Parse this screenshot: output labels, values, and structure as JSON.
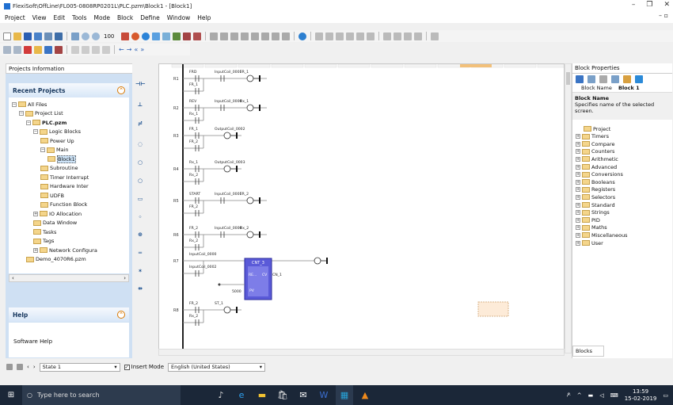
{
  "window": {
    "title": "FlexiSoft\\OffLine\\FL005-0808RP0201L\\PLC.pzm\\Block1 - [Block1]",
    "controls": [
      "–",
      "❐",
      "✕"
    ]
  },
  "menu": [
    "Project",
    "View",
    "Edit",
    "Tools",
    "Mode",
    "Block",
    "Define",
    "Window",
    "Help"
  ],
  "toolbar": {
    "zoom": "100"
  },
  "projects_panel": {
    "title": "Projects Information",
    "pin": "⊕‹",
    "recent_label": "Recent Projects",
    "tree": [
      {
        "label": "All Files",
        "level": 0,
        "pm": "−"
      },
      {
        "label": "Project List",
        "level": 1,
        "pm": "−"
      },
      {
        "label": "PLC.pzm",
        "level": 2,
        "pm": "−",
        "bold": true
      },
      {
        "label": "Logic Blocks",
        "level": 3,
        "pm": "−"
      },
      {
        "label": "Power Up",
        "level": 4,
        "pm": ""
      },
      {
        "label": "Main",
        "level": 4,
        "pm": "−"
      },
      {
        "label": "Block1",
        "level": 5,
        "pm": "",
        "selected": true
      },
      {
        "label": "Subroutine",
        "level": 4,
        "pm": ""
      },
      {
        "label": "Timer Interrupt",
        "level": 4,
        "pm": ""
      },
      {
        "label": "Hardware Inter",
        "level": 4,
        "pm": ""
      },
      {
        "label": "UDFB",
        "level": 4,
        "pm": ""
      },
      {
        "label": "Function Block",
        "level": 4,
        "pm": ""
      },
      {
        "label": "IO Allocation",
        "level": 3,
        "pm": "+"
      },
      {
        "label": "Data Window",
        "level": 3,
        "pm": ""
      },
      {
        "label": "Tasks",
        "level": 3,
        "pm": ""
      },
      {
        "label": "Tags",
        "level": 3,
        "pm": ""
      },
      {
        "label": "Network Configura",
        "level": 3,
        "pm": "+"
      },
      {
        "label": "Demo_4070R6.pzm",
        "level": 2,
        "pm": ""
      }
    ],
    "help_label": "Help",
    "software_help": "Software Help"
  },
  "ladder": {
    "rungs": [
      {
        "id": "R1",
        "contacts": [
          [
            "FRD",
            "InputCoil_0001",
            "FR_1"
          ],
          [
            "FR_1"
          ]
        ]
      },
      {
        "id": "R2",
        "contacts": [
          [
            "REV",
            "InputCoil_0000",
            "Rx_1"
          ],
          [
            "Rx_1"
          ]
        ]
      },
      {
        "id": "R3",
        "contacts": [
          [
            "FR_1",
            "OutputCoil_0002"
          ],
          [
            "FR_2"
          ]
        ]
      },
      {
        "id": "R4",
        "contacts": [
          [
            "Rx_1",
            "OutputCoil_0003"
          ],
          [
            "Rx_2"
          ]
        ]
      },
      {
        "id": "R5",
        "contacts": [
          [
            "START",
            "InputCoil_0001",
            "FR_2"
          ],
          [
            "FR_2"
          ]
        ]
      },
      {
        "id": "R6",
        "contacts": [
          [
            "FR_2",
            "InputCoil_0000",
            "Rx_2"
          ],
          [
            "Rx_2"
          ]
        ]
      },
      {
        "id": "R7",
        "contacts": [
          [
            "InputCoil_0000"
          ],
          [
            "InputCoil_0002"
          ]
        ]
      },
      {
        "id": "R8",
        "contacts": [
          [
            "FR_2",
            "ST_1"
          ],
          [
            "Rx_2"
          ]
        ]
      }
    ],
    "counter": {
      "name": "CNT_3",
      "in1": "RE...",
      "out": "CV",
      "outlabel": "CN_1",
      "pv": "5000",
      "pvlbl": "PV"
    }
  },
  "block_properties": {
    "title": "Block Properties",
    "field_label": "Block Name",
    "field_value": "Block 1",
    "desc_title": "Block Name",
    "desc_text": "Specifies name of the selected screen.",
    "tree": [
      "Project",
      "Timers",
      "Compare",
      "Counters",
      "Arithmetic",
      "Advanced",
      "Conversions",
      "Booleans",
      "Registers",
      "Selectors",
      "Standard",
      "Strings",
      "PID",
      "Maths",
      "Miscellaneous",
      "User"
    ],
    "tab": "Blocks"
  },
  "status": {
    "state": "State 1",
    "insert_mode": "Insert Mode",
    "language": "English (United States)"
  },
  "taskbar": {
    "search": "Type here to search",
    "time": "13:59",
    "date": "15-02-2019"
  }
}
